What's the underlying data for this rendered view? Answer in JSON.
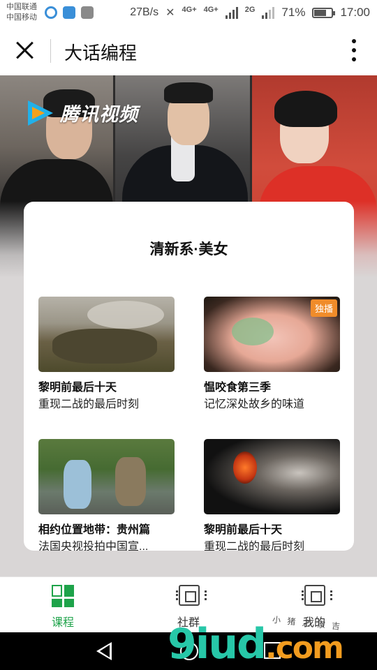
{
  "status_bar": {
    "carrier_1": "中国联通",
    "carrier_2": "中国移动",
    "net_speed": "27B/s",
    "network_4g": "4G+",
    "network_4g_2": "4G+",
    "network_2g": "2G",
    "battery": "71%",
    "battery_level": 0.71,
    "time": "17:00"
  },
  "header": {
    "title": "大话编程"
  },
  "banner": {
    "logo_text": "腾讯视频"
  },
  "card": {
    "title": "清新系·美女",
    "items": [
      {
        "title": "黎明前最后十天",
        "subtitle": "重现二战的最后时刻",
        "badge": ""
      },
      {
        "title": "愠咬食第三季",
        "subtitle": "记忆深处故乡的味道",
        "badge": "独播"
      },
      {
        "title": "相约位置地带：贵州篇",
        "subtitle": "法国央视投拍中国宣...",
        "badge": ""
      },
      {
        "title": "黎明前最后十天",
        "subtitle": "重现二战的最后时刻",
        "badge": ""
      }
    ]
  },
  "tabbar": {
    "tabs": [
      {
        "label": "课程",
        "icon": "grid-icon",
        "active": true
      },
      {
        "label": "社群",
        "icon": "chip-icon",
        "active": false
      },
      {
        "label": "我的",
        "icon": "chip-icon",
        "active": false
      }
    ]
  },
  "watermark": {
    "main": "9iud",
    "suffix": ".com",
    "sub": "小 猪 之 家 吉"
  },
  "colors": {
    "accent_green": "#1ea34a",
    "badge_orange": "#f08c2a"
  }
}
